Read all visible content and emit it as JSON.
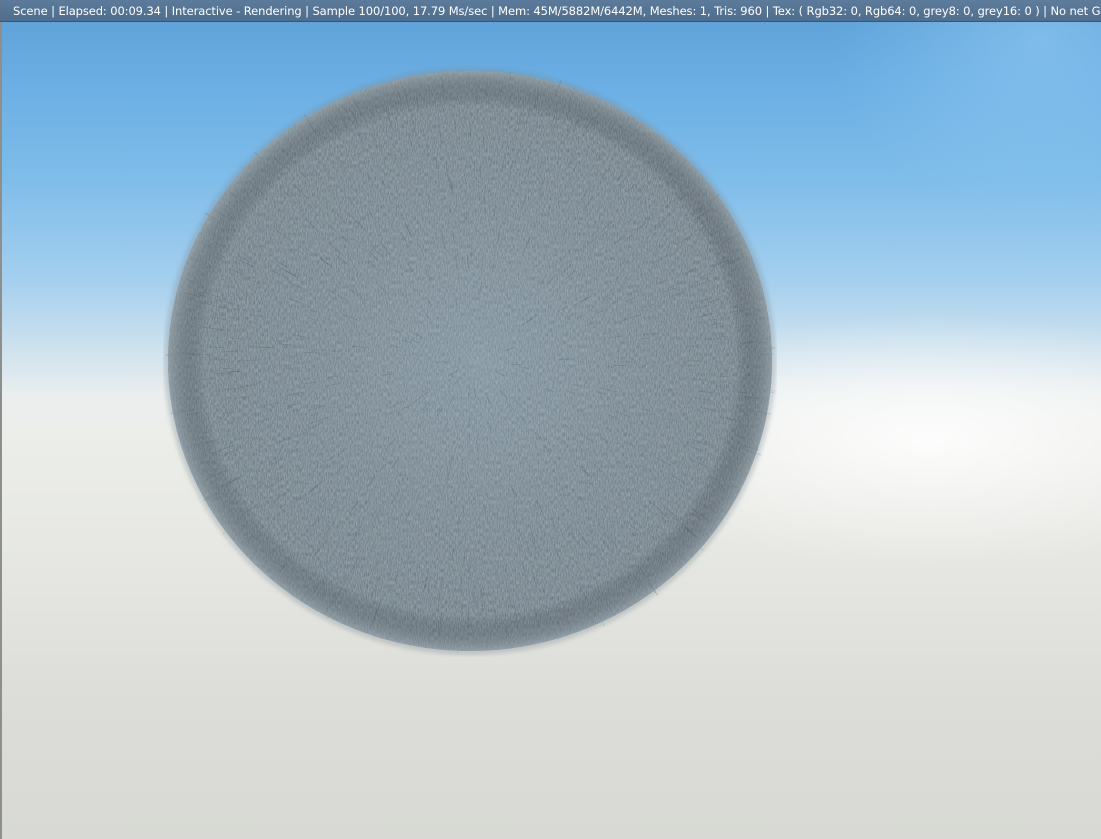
{
  "status_bar": {
    "text": "Scene | Elapsed: 00:09.34 | Interactive - Rendering | Sample 100/100, 17.79 Ms/sec | Mem: 45M/5882M/6442M, Meshes: 1, Tris: 960 | Tex: ( Rgb32: 0, Rgb64: 0, grey8: 0, grey16: 0 ) | No net GPUs"
  },
  "render": {
    "subject": "fur-covered sphere",
    "fur_color": "#5e6e78",
    "sky_color": "#5b9fd6",
    "ground_color": "#dcddd8"
  }
}
